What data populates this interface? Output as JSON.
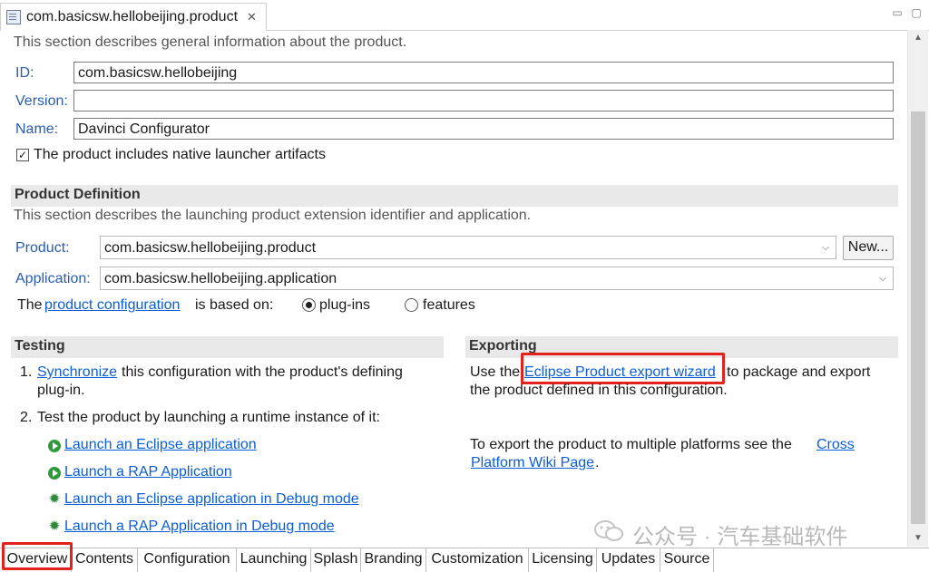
{
  "editor_tab": {
    "title": "com.basicsw.hellobeijing.product",
    "close": "✕"
  },
  "general": {
    "description": "This section describes general information about the product.",
    "id_label": "ID:",
    "id_value": "com.basicsw.hellobeijing",
    "version_label": "Version:",
    "version_value": "",
    "name_label": "Name:",
    "name_value": "Davinci Configurator",
    "native_launcher_label": "The product includes native launcher artifacts",
    "native_launcher_checked": true
  },
  "product_definition": {
    "heading": "Product Definition",
    "description": "This section describes the launching product extension identifier and application.",
    "product_label": "Product:",
    "product_value": "com.basicsw.hellobeijing.product",
    "new_button": "New...",
    "application_label": "Application:",
    "application_value": "com.basicsw.hellobeijing.application",
    "config_prefix": "The",
    "config_link": "product configuration",
    "config_suffix": "is based on:",
    "option_plugins": "plug-ins",
    "option_features": "features",
    "selected": "plug-ins"
  },
  "testing": {
    "heading": "Testing",
    "step1_num": "1.",
    "step1_link": "Synchronize",
    "step1_text_a": "this configuration with the product's defining",
    "step1_text_b": "plug-in.",
    "step2_num": "2.",
    "step2_text": "Test the product by launching a runtime instance of it:",
    "launches": [
      {
        "label": "Launch an Eclipse application",
        "icon": "run-icon"
      },
      {
        "label": "Launch a RAP Application",
        "icon": "run-icon"
      },
      {
        "label": "Launch an Eclipse application in Debug mode",
        "icon": "debug-icon"
      },
      {
        "label": "Launch a RAP Application in Debug mode",
        "icon": "debug-icon"
      }
    ]
  },
  "exporting": {
    "heading": "Exporting",
    "use_the": "Use the",
    "wizard_link": "Eclipse Product export wizard",
    "after_link": "to package and export",
    "line2": "the product defined in this configuration.",
    "multi_text": "To export the product to multiple platforms see the",
    "cross_link_a": "Cross",
    "cross_link_b": "Platform Wiki Page",
    "period": "."
  },
  "page_tabs": [
    "Overview",
    "Contents",
    "Configuration",
    "Launching",
    "Splash",
    "Branding",
    "Customization",
    "Licensing",
    "Updates",
    "Source"
  ],
  "active_tab": "Overview",
  "watermark": "公众号 · 汽车基础软件",
  "colors": {
    "link": "#0b5ed7",
    "label": "#2a5db0",
    "highlight": "#e5211d",
    "section_bg": "#e9e9e9"
  }
}
